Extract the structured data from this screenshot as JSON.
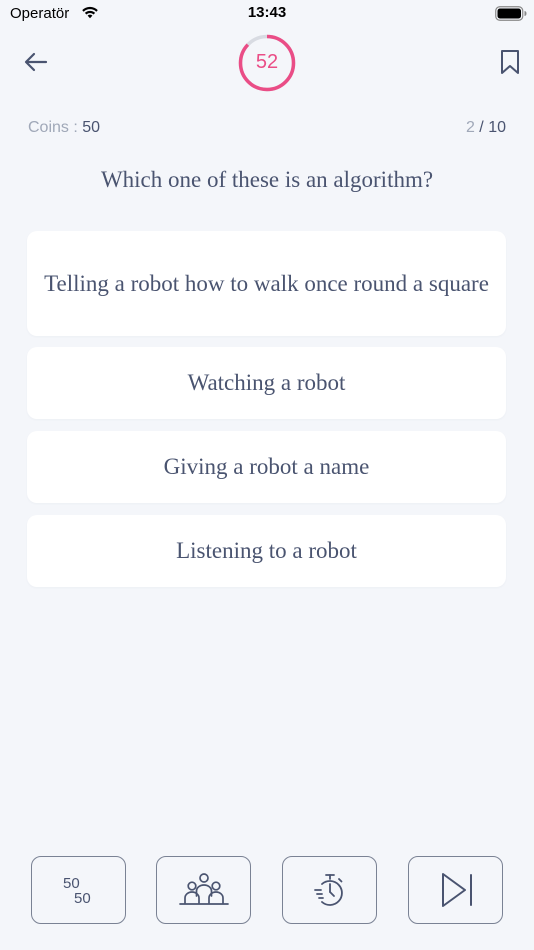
{
  "status_bar": {
    "carrier": "Operatör",
    "time": "13:43"
  },
  "timer": {
    "value": "52",
    "progress_fraction": 0.87,
    "color": "#ea4d86"
  },
  "info": {
    "coins_label": "Coins : ",
    "coins_value": "50",
    "progress_current": "2",
    "progress_separator": " / ",
    "progress_total": "10"
  },
  "question": "Which one of these is an algorithm?",
  "answers": [
    "Telling a robot how to walk once round a square",
    "Watching a robot",
    "Giving a robot a name",
    "Listening to a robot"
  ],
  "lifelines": {
    "fifty_fifty_icon": "fifty-fifty-icon",
    "audience_icon": "audience-icon",
    "time_icon": "stopwatch-icon",
    "skip_icon": "skip-icon",
    "fifty_top": "50",
    "fifty_bottom": "50"
  },
  "colors": {
    "background": "#f4f6fa",
    "text": "#4a5470",
    "muted": "#a0a8b8",
    "accent": "#ea4d86"
  }
}
